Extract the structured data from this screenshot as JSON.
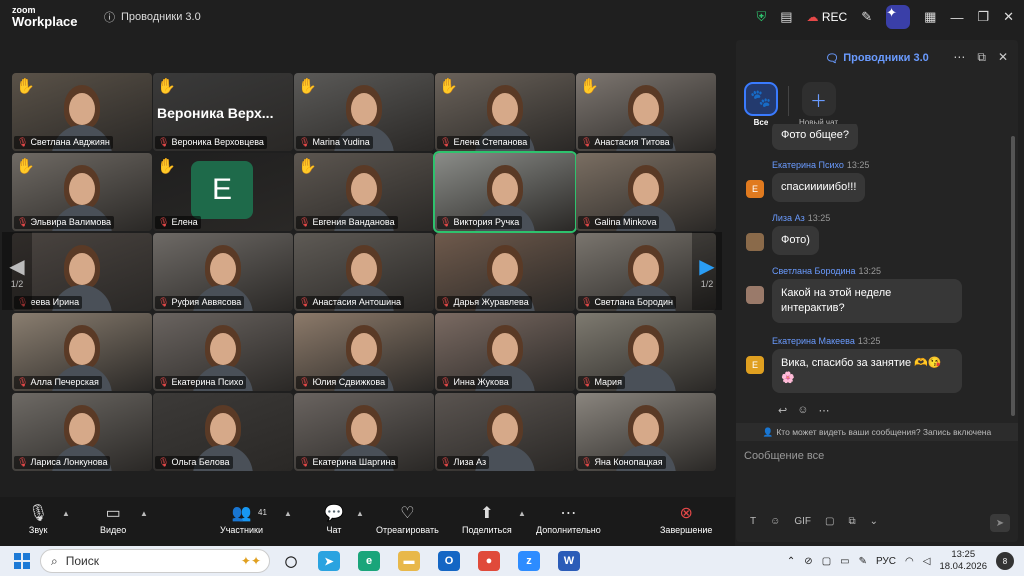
{
  "window": {
    "brand_top": "zoom",
    "brand_bottom": "Workplace",
    "meeting_title": "Проводники 3.0",
    "rec_label": "REC",
    "icons": [
      "shield-icon",
      "notes-icon",
      "cloud-rec-icon",
      "pen-icon",
      "ai-companion-icon",
      "apps-icon",
      "minimize-icon",
      "restore-icon",
      "close-icon"
    ]
  },
  "gallery": {
    "page_left": "1/2",
    "page_right": "1/2",
    "tiles": [
      {
        "name": "Светлана  Авджиян",
        "hand": true
      },
      {
        "name": "Вероника Верховцева",
        "hand": true,
        "big_label": "Вероника  Верх..."
      },
      {
        "name": "Marina Yudina",
        "hand": true
      },
      {
        "name": "Елена Степанова",
        "hand": true
      },
      {
        "name": "Анастасия Титова",
        "hand": true
      },
      {
        "name": "Эльвира Валимова",
        "hand": true
      },
      {
        "name": "Елена",
        "hand": true,
        "avatar_letter": "E"
      },
      {
        "name": "Евгения Ванданова",
        "hand": true
      },
      {
        "name": "Виктория Ручка",
        "hand": false,
        "active": true
      },
      {
        "name": "Galina Minkova",
        "hand": false
      },
      {
        "name": "еева Ирина",
        "hand": false
      },
      {
        "name": "Руфия Аввясова",
        "hand": false
      },
      {
        "name": "Анастасия Антошина",
        "hand": false
      },
      {
        "name": "Дарья Журавлева",
        "hand": false
      },
      {
        "name": "Светлана Бородин",
        "hand": false
      },
      {
        "name": "Алла Печерская",
        "hand": false
      },
      {
        "name": "Екатерина Психо",
        "hand": false
      },
      {
        "name": "Юлия Сдвижкова",
        "hand": false
      },
      {
        "name": "Инна Жукова",
        "hand": false
      },
      {
        "name": "Мария",
        "hand": false
      },
      {
        "name": "Лариса Лонкунова",
        "hand": false
      },
      {
        "name": "Ольга Белова",
        "hand": false
      },
      {
        "name": "Екатерина Шаргина",
        "hand": false
      },
      {
        "name": "Лиза Аз",
        "hand": false
      },
      {
        "name": "Яна Конопацкая",
        "hand": false
      }
    ]
  },
  "toolbar": {
    "audio": "Звук",
    "video": "Видео",
    "participants": "Участники",
    "participants_count": "41",
    "chat": "Чат",
    "react": "Отреагировать",
    "share": "Поделиться",
    "more": "Дополнительно",
    "end": "Завершение"
  },
  "chat": {
    "title": "Проводники 3.0",
    "tab_all": "Все",
    "tab_new": "Новый чат",
    "messages": [
      {
        "sender": "",
        "time": "",
        "text": "Фото общее?"
      },
      {
        "sender": "Екатерина Психо",
        "time": "13:25",
        "text": "спасииииибо!!!",
        "avatar": "E",
        "avatar_color": "#e07a1f"
      },
      {
        "sender": "Лиза Аз",
        "time": "13:25",
        "text": "Фото)",
        "avatar": "",
        "avatar_color": "#8a6a4a"
      },
      {
        "sender": "Светлана Бородина",
        "time": "13:25",
        "text": "Какой на этой неделе интерактив?",
        "avatar": "",
        "avatar_color": "#9a7a6a"
      },
      {
        "sender": "Екатерина Макеева",
        "time": "13:25",
        "text": "Вика, спасибо за занятие 🫶😘🌸",
        "avatar": "E",
        "avatar_color": "#e0a020"
      }
    ],
    "privacy_note": "Кто может видеть ваши сообщения? Запись включена",
    "input_placeholder": "Сообщение все",
    "tools": [
      "T",
      "☺",
      "GIF",
      "▢",
      "⧉",
      "⌄"
    ]
  },
  "taskbar": {
    "search_placeholder": "Поиск",
    "lang": "РУС",
    "time": "13:25",
    "date": "18.04.2026",
    "notifications": "8"
  }
}
